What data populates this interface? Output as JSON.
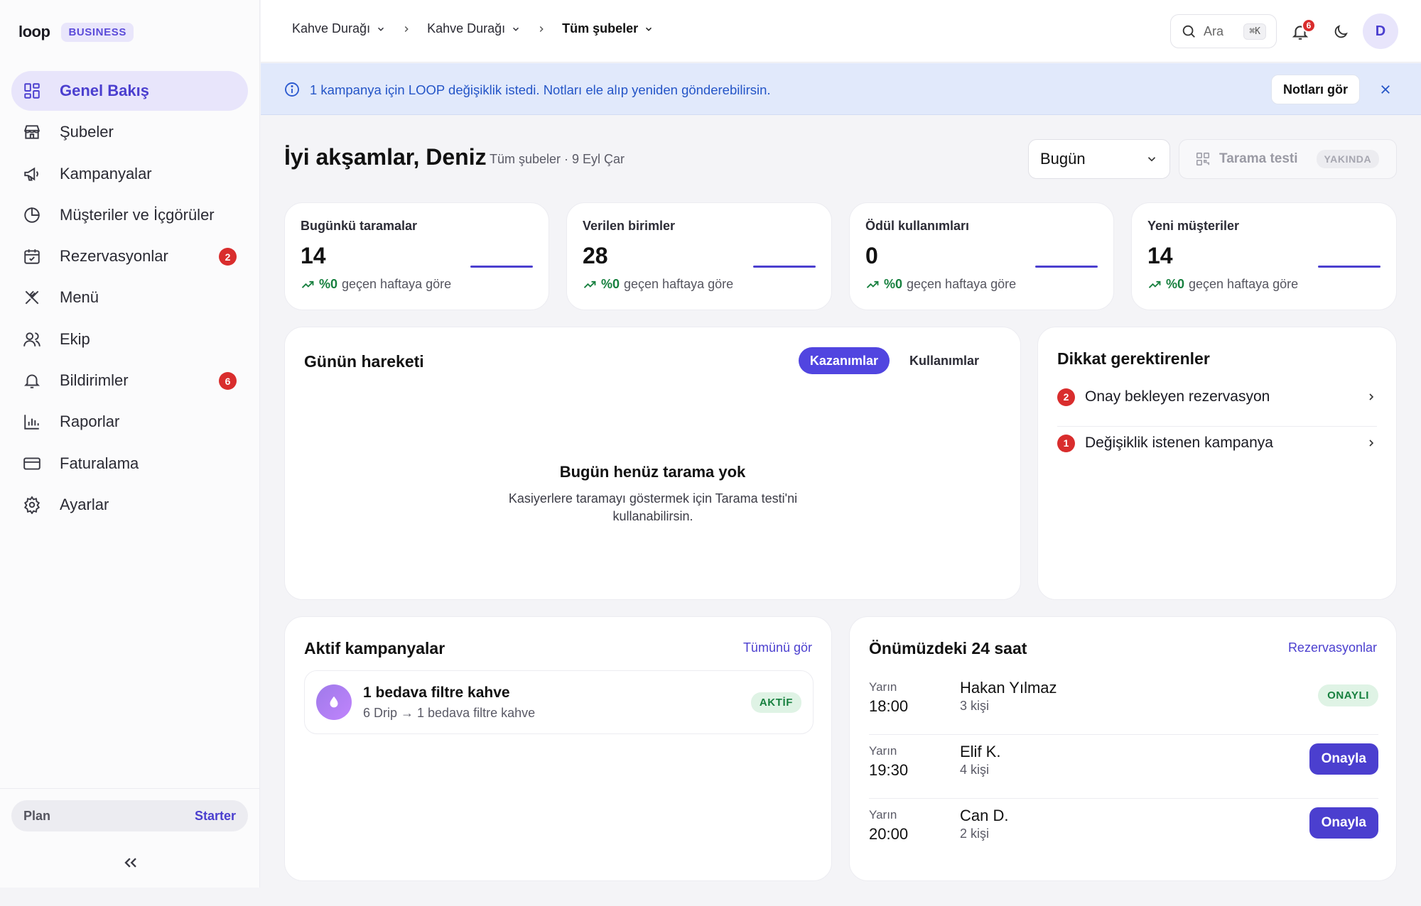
{
  "brand": {
    "logo": "loop",
    "badge": "BUSINESS"
  },
  "sidebar": {
    "items": [
      {
        "label": "Genel Bakış",
        "icon": "dashboard-icon",
        "active": true
      },
      {
        "label": "Şubeler",
        "icon": "store-icon"
      },
      {
        "label": "Kampanyalar",
        "icon": "megaphone-icon"
      },
      {
        "label": "Müşteriler ve İçgörüler",
        "icon": "pie-chart-icon"
      },
      {
        "label": "Rezervasyonlar",
        "icon": "calendar-icon",
        "badge": "2"
      },
      {
        "label": "Menü",
        "icon": "utensils-icon"
      },
      {
        "label": "Ekip",
        "icon": "users-icon"
      },
      {
        "label": "Bildirimler",
        "icon": "bell-icon",
        "badge": "6"
      },
      {
        "label": "Raporlar",
        "icon": "bar-chart-icon"
      },
      {
        "label": "Faturalama",
        "icon": "credit-card-icon"
      },
      {
        "label": "Ayarlar",
        "icon": "gear-icon"
      }
    ],
    "plan_label": "Plan",
    "plan_value": "Starter"
  },
  "topbar": {
    "breadcrumbs": [
      "Kahve Durağı",
      "Kahve Durağı",
      "Tüm şubeler"
    ],
    "search_label": "Ara",
    "search_shortcut": "⌘K",
    "notification_count": "6",
    "avatar_initial": "D"
  },
  "banner": {
    "text": "1 kampanya için LOOP değişiklik istedi. Notları ele alıp yeniden gönderebilirsin.",
    "button": "Notları gör"
  },
  "header": {
    "greeting": "İyi akşamlar, Deniz",
    "subtitle": "Tüm şubeler · 9 Eyl Çar",
    "period": "Bugün",
    "scan_test": "Tarama testi",
    "scan_test_badge": "YAKINDA"
  },
  "stats": [
    {
      "title": "Bugünkü taramalar",
      "value": "14",
      "pct": "%0",
      "suffix": "geçen haftaya göre"
    },
    {
      "title": "Verilen birimler",
      "value": "28",
      "pct": "%0",
      "suffix": "geçen haftaya göre"
    },
    {
      "title": "Ödül kullanımları",
      "value": "0",
      "pct": "%0",
      "suffix": "geçen haftaya göre"
    },
    {
      "title": "Yeni müşteriler",
      "value": "14",
      "pct": "%0",
      "suffix": "geçen haftaya göre"
    }
  ],
  "activity": {
    "title": "Günün hareketi",
    "tab_earnings": "Kazanımlar",
    "tab_redemptions": "Kullanımlar",
    "empty_title": "Bugün henüz tarama yok",
    "empty_desc": "Kasiyerlere taramayı göstermek için Tarama testi'ni kullanabilirsin."
  },
  "attention": {
    "title": "Dikkat gerektirenler",
    "items": [
      {
        "count": "2",
        "label": "Onay bekleyen rezervasyon"
      },
      {
        "count": "1",
        "label": "Değişiklik istenen kampanya"
      }
    ]
  },
  "campaigns": {
    "title": "Aktif kampanyalar",
    "link": "Tümünü gör",
    "items": [
      {
        "name": "1 bedava filtre kahve",
        "desc": "6 Drip → 1 bedava filtre kahve",
        "status": "AKTİF"
      }
    ]
  },
  "upcoming": {
    "title": "Önümüzdeki 24 saat",
    "link": "Rezervasyonlar",
    "items": [
      {
        "day": "Yarın",
        "time": "18:00",
        "name": "Hakan Yılmaz",
        "people": "3 kişi",
        "status": "ONAYLI"
      },
      {
        "day": "Yarın",
        "time": "19:30",
        "name": "Elif K.",
        "people": "4 kişi",
        "action": "Onayla"
      },
      {
        "day": "Yarın",
        "time": "20:00",
        "name": "Can D.",
        "people": "2 kişi",
        "action": "Onayla"
      }
    ]
  },
  "colors": {
    "accent": "#4b3fcf",
    "danger": "#d92d2d",
    "success": "#17803f",
    "banner": "#e1e9fb"
  }
}
